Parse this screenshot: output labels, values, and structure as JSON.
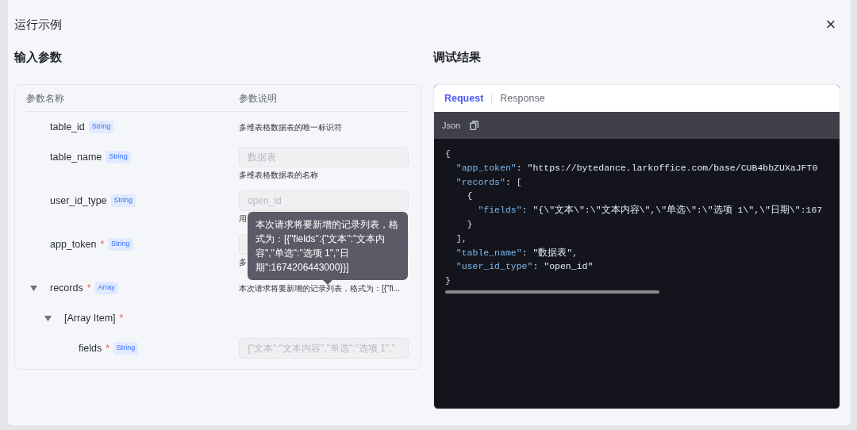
{
  "dialog": {
    "title": "运行示例",
    "close": "×"
  },
  "input": {
    "title": "输入参数",
    "columns": [
      "参数名称",
      "参数说明"
    ],
    "params": [
      {
        "name": "table_id",
        "type": "String",
        "description": "多维表格数据表的唯一标识符"
      },
      {
        "name": "table_name",
        "type": "String",
        "field": {
          "disabled": true,
          "placeholder": "数据表"
        },
        "description": "多维表格数据表的名称"
      },
      {
        "name": "user_id_type",
        "type": "String",
        "field": {
          "disabled": true,
          "placeholder": "open_id"
        },
        "description": "用"
      },
      {
        "name": "app_token",
        "required_mark": "*",
        "type": "String",
        "field": {
          "disabled": true
        },
        "description": "多"
      },
      {
        "name": "records",
        "required_mark": "*",
        "type": "Array",
        "expanded": true,
        "description": "本次请求将要新增的记录列表，格式为：[{\"fi...",
        "children": [
          {
            "name": "[Array Item]",
            "required_mark": "*",
            "expanded": true,
            "children": [
              {
                "name": "fields",
                "required_mark": "*",
                "type": "String",
                "field": {
                  "disabled": true,
                  "placeholder": "{\"文本\":\"文本内容\",\"单选\":\"选项 1\",\""
                }
              }
            ]
          }
        ]
      }
    ],
    "tooltip": "本次请求将要新增的记录列表，格式为：[{\"fields\":{\"文本\":\"文本内容\",\"单选\":\"选项 1\",\"日期\":1674206443000}}]"
  },
  "result": {
    "title": "调试结果",
    "tabs": [
      {
        "label": "Request",
        "selected": true
      },
      {
        "label": "Response",
        "selected": false
      }
    ],
    "format": "Json",
    "code": [
      [
        {
          "kind": "punct",
          "text": "{"
        }
      ],
      [
        {
          "kind": "key",
          "text": "  \"app_token\""
        },
        {
          "kind": "punct",
          "text": ": "
        },
        {
          "kind": "value",
          "text": "\"https://bytedance.larkoffice.com/base/CUB4bbZUXaJFT0"
        }
      ],
      [
        {
          "kind": "key",
          "text": "  \"records\""
        },
        {
          "kind": "punct",
          "text": ": ["
        }
      ],
      [
        {
          "kind": "punct",
          "text": "    {"
        }
      ],
      [
        {
          "kind": "key",
          "text": "      \"fields\""
        },
        {
          "kind": "punct",
          "text": ": "
        },
        {
          "kind": "value",
          "text": "\"{\\\"文本\\\":\\\"文本内容\\\",\\\"单选\\\":\\\"选项 1\\\",\\\"日期\\\":167"
        }
      ],
      [
        {
          "kind": "punct",
          "text": "    }"
        }
      ],
      [
        {
          "kind": "punct",
          "text": "  ],"
        }
      ],
      [
        {
          "kind": "key",
          "text": "  \"table_name\""
        },
        {
          "kind": "punct",
          "text": ": "
        },
        {
          "kind": "value",
          "text": "\"数据表\""
        },
        {
          "kind": "punct",
          "text": ","
        }
      ],
      [
        {
          "kind": "key",
          "text": "  \"user_id_type\""
        },
        {
          "kind": "punct",
          "text": ": "
        },
        {
          "kind": "value",
          "text": "\"open_id\""
        }
      ],
      [
        {
          "kind": "punct",
          "text": "}"
        }
      ]
    ]
  }
}
